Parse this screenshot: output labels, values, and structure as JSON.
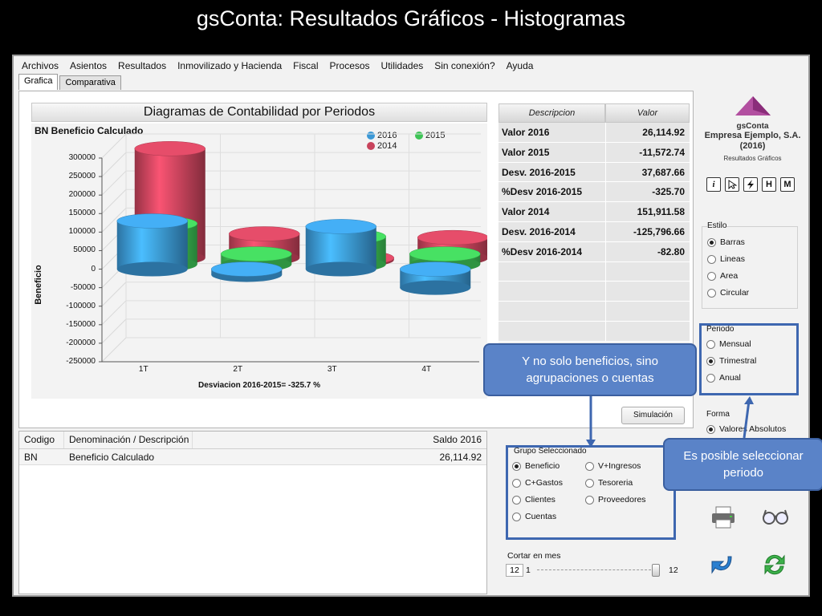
{
  "slide": {
    "title": "gsConta: Resultados Gráficos  - Histogramas"
  },
  "menu": [
    "Archivos",
    "Asientos",
    "Resultados",
    "Inmovilizado y Hacienda",
    "Fiscal",
    "Procesos",
    "Utilidades",
    "Sin conexión?",
    "Ayuda"
  ],
  "tabs": [
    "Grafica",
    "Comparativa"
  ],
  "chart_data": {
    "type": "bar",
    "title": "Diagramas de Contabilidad por Periodos",
    "subtitle": "BN  Beneficio Calculado",
    "categories": [
      "1T",
      "2T",
      "3T",
      "4T"
    ],
    "series": [
      {
        "name": "2016",
        "color": "#3b98d6",
        "values": [
          130000,
          -15000,
          115000,
          -50000
        ]
      },
      {
        "name": "2015",
        "color": "#3ec456",
        "values": [
          110000,
          28000,
          75000,
          28000
        ]
      },
      {
        "name": "2014",
        "color": "#c8435c",
        "values": [
          295000,
          65000,
          -5000,
          55000
        ]
      }
    ],
    "ylabel": "Beneficio",
    "xlabel": "",
    "yticks": [
      "300000",
      "250000",
      "200000",
      "150000",
      "100000",
      "50000",
      "0",
      "-50000",
      "-100000",
      "-150000",
      "-200000",
      "-250000"
    ],
    "ylim": [
      -250000,
      300000
    ],
    "footer": "Desviacion 2016-2015= -325.7 %",
    "legend_position": "top-right",
    "grid": true
  },
  "stats": {
    "header_desc": "Descripcion",
    "header_val": "Valor",
    "rows": [
      {
        "label": "Valor 2016",
        "value": "26,114.92"
      },
      {
        "label": "Valor 2015",
        "value": "-11,572.74"
      },
      {
        "label": "Desv. 2016-2015",
        "value": "37,687.66"
      },
      {
        "label": "%Desv 2016-2015",
        "value": "-325.70"
      },
      {
        "label": "Valor 2014",
        "value": "151,911.58"
      },
      {
        "label": "Desv. 2016-2014",
        "value": "-125,796.66"
      },
      {
        "label": "%Desv 2016-2014",
        "value": "-82.80"
      }
    ]
  },
  "simulacion_label": "Simulación",
  "logo": {
    "name": "gsConta",
    "company": "Empresa Ejemplo, S.A.",
    "year": "(2016)",
    "sub": "Resultados Gráficos"
  },
  "small_icons": [
    "i",
    "",
    "",
    "H",
    "M"
  ],
  "estilo": {
    "title": "Estilo",
    "options": [
      "Barras",
      "Lineas",
      "Area",
      "Circular"
    ],
    "selected": 0
  },
  "periodo": {
    "title": "Periodo",
    "options": [
      "Mensual",
      "Trimestral",
      "Anual"
    ],
    "selected": 1
  },
  "forma": {
    "title": "Forma",
    "option": "Valores Absolutos"
  },
  "grupo": {
    "title": "Grupo Seleccionado",
    "left": [
      "Beneficio",
      "C+Gastos",
      "Clientes",
      "Cuentas"
    ],
    "right": [
      "V+Ingresos",
      "Tesoreria",
      "Proveedores"
    ],
    "selected": "Beneficio"
  },
  "bottom_table": {
    "headers": [
      "Codigo",
      "Denominación / Descripción",
      "Saldo 2016"
    ],
    "rows": [
      [
        "BN",
        "Beneficio Calculado",
        "26,114.92"
      ]
    ]
  },
  "slider": {
    "label": "Cortar en mes",
    "value": "12",
    "min": "1",
    "max": "12",
    "position": 1.0
  },
  "callouts": {
    "left": "Y no solo beneficios, sino agrupaciones o cuentas",
    "right": "Es posible seleccionar periodo"
  }
}
